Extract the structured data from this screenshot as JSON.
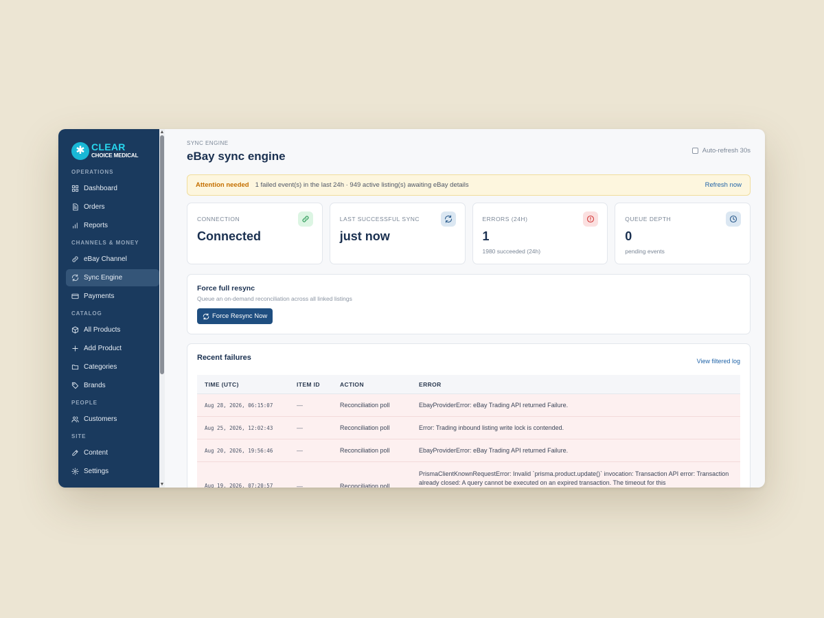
{
  "brand": {
    "name": "CLEAR",
    "sub": "CHOICE MEDICAL"
  },
  "sidebar": {
    "sections": [
      {
        "label": "OPERATIONS",
        "items": [
          {
            "label": "Dashboard",
            "icon": "grid-icon"
          },
          {
            "label": "Orders",
            "icon": "document-icon"
          },
          {
            "label": "Reports",
            "icon": "bar-chart-icon"
          }
        ]
      },
      {
        "label": "CHANNELS & MONEY",
        "items": [
          {
            "label": "eBay Channel",
            "icon": "link-icon"
          },
          {
            "label": "Sync Engine",
            "icon": "refresh-icon",
            "active": true
          },
          {
            "label": "Payments",
            "icon": "credit-card-icon"
          }
        ]
      },
      {
        "label": "CATALOG",
        "items": [
          {
            "label": "All Products",
            "icon": "box-icon"
          },
          {
            "label": "Add Product",
            "icon": "plus-icon"
          },
          {
            "label": "Categories",
            "icon": "folder-icon"
          },
          {
            "label": "Brands",
            "icon": "tag-icon"
          }
        ]
      },
      {
        "label": "PEOPLE",
        "items": [
          {
            "label": "Customers",
            "icon": "users-icon"
          }
        ]
      },
      {
        "label": "SITE",
        "items": [
          {
            "label": "Content",
            "icon": "edit-icon"
          },
          {
            "label": "Settings",
            "icon": "gear-icon"
          }
        ]
      }
    ]
  },
  "header": {
    "eyebrow": "SYNC ENGINE",
    "title": "eBay sync engine",
    "auto_refresh": "Auto-refresh 30s"
  },
  "alert": {
    "title": "Attention needed",
    "text": "1 failed event(s) in the last 24h · 949 active listing(s) awaiting eBay details",
    "action": "Refresh now"
  },
  "stats": [
    {
      "label": "CONNECTION",
      "value": "Connected",
      "sub": "",
      "icon": "link-icon",
      "accent": "#dcf5e3",
      "icon_color": "#2c9a57"
    },
    {
      "label": "LAST SUCCESSFUL SYNC",
      "value": "just now",
      "sub": "",
      "icon": "refresh-icon",
      "accent": "#dbe7f2",
      "icon_color": "#2a5b8c"
    },
    {
      "label": "ERRORS (24H)",
      "value": "1",
      "sub": "1980 succeeded (24h)",
      "icon": "alert-circle-icon",
      "accent": "#fbe0e0",
      "icon_color": "#d23b3b"
    },
    {
      "label": "QUEUE DEPTH",
      "value": "0",
      "sub": "pending events",
      "icon": "clock-icon",
      "accent": "#dbe7f2",
      "icon_color": "#2a5b8c"
    }
  ],
  "resync": {
    "title": "Force full resync",
    "subtitle": "Queue an on-demand reconciliation across all linked listings",
    "button": "Force Resync Now"
  },
  "failures": {
    "title": "Recent failures",
    "view_link": "View filtered log",
    "columns": [
      "TIME (UTC)",
      "ITEM ID",
      "ACTION",
      "ERROR"
    ],
    "rows": [
      {
        "time": "Aug 28, 2026, 06:15:07",
        "item": "—",
        "action": "Reconciliation poll",
        "error": "EbayProviderError: eBay Trading API returned Failure."
      },
      {
        "time": "Aug 25, 2026, 12:02:43",
        "item": "—",
        "action": "Reconciliation poll",
        "error": "Error: Trading inbound listing write lock is contended."
      },
      {
        "time": "Aug 20, 2026, 19:56:46",
        "item": "—",
        "action": "Reconciliation poll",
        "error": "EbayProviderError: eBay Trading API returned Failure."
      },
      {
        "time": "Aug 19, 2026, 07:20:57",
        "item": "—",
        "action": "Reconciliation poll",
        "error": "PrismaClientKnownRequestError: Invalid `prisma.product.update()` invocation: Transaction API error: Transaction already closed: A query cannot be executed on an expired transaction. The timeout for this"
      }
    ]
  },
  "colors": {
    "sidebar_bg": "#1a3a5e",
    "accent": "#1f4e80",
    "alert_title": "#c46f00",
    "error_row_bg": "#fdf0f0"
  }
}
